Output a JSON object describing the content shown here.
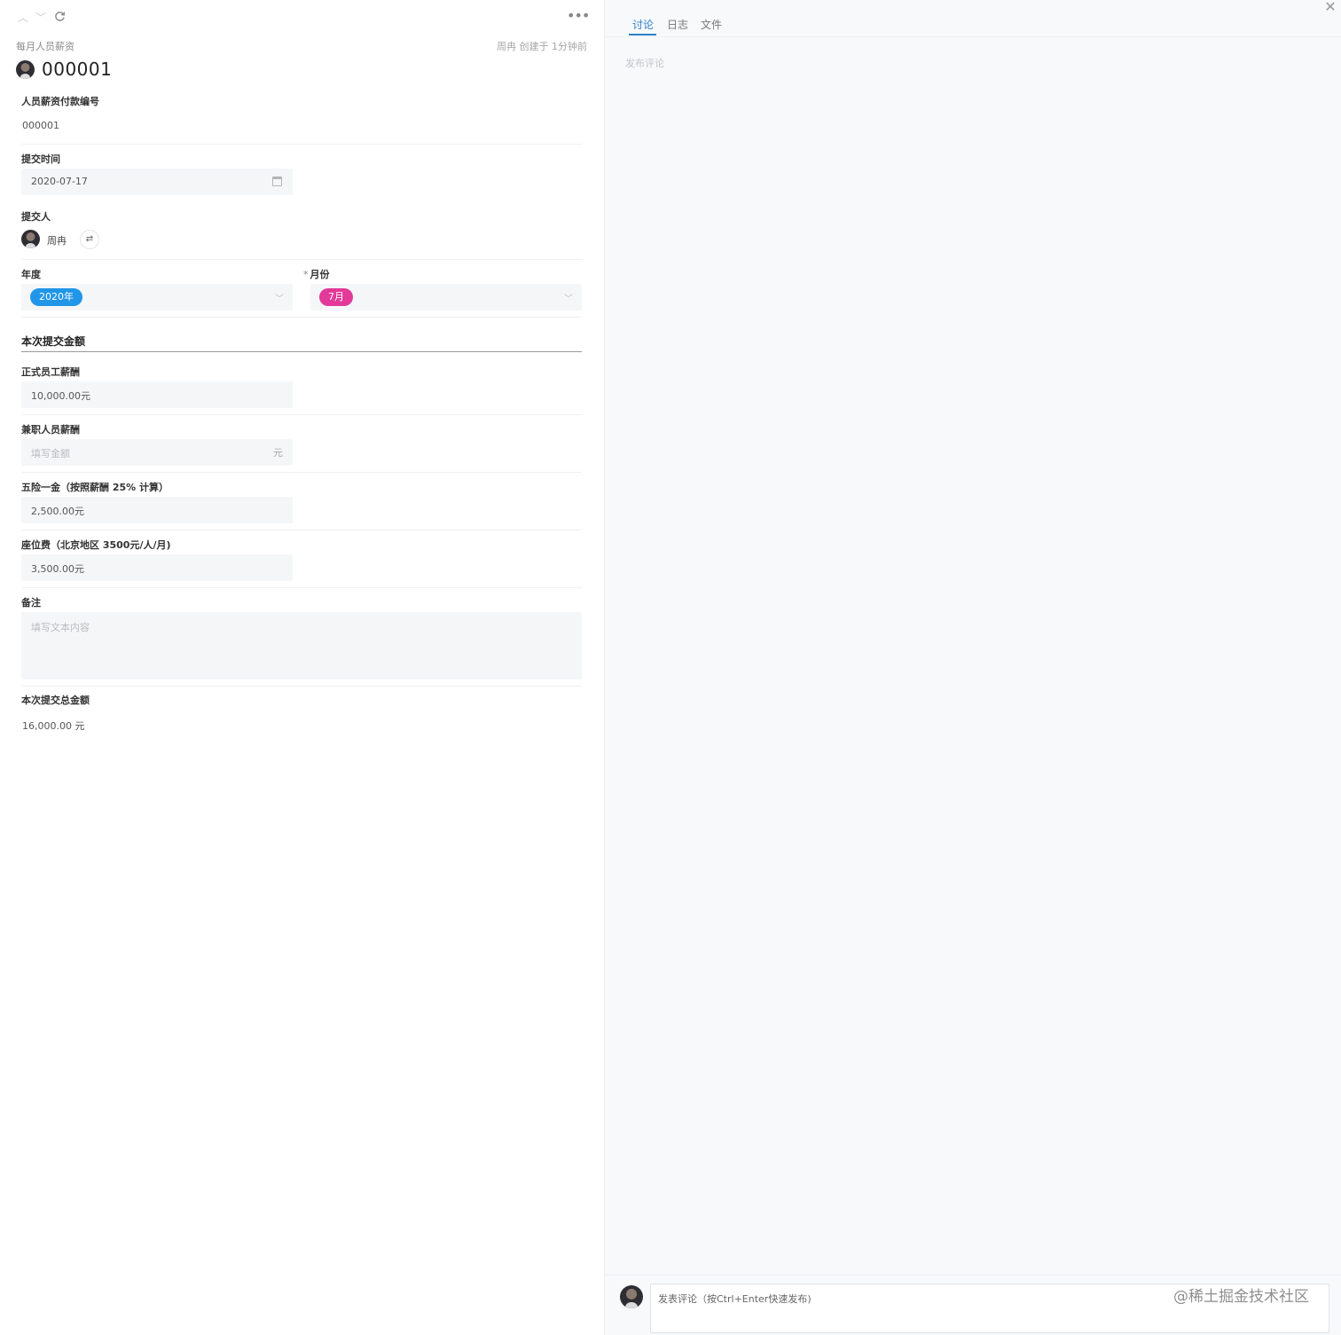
{
  "record": {
    "app_name": "每月人员薪资",
    "created_info": "周冉 创建于 1分钟前",
    "title": "000001"
  },
  "fields": {
    "payment_no": {
      "label": "人员薪资付款编号",
      "value": "000001"
    },
    "submit_time": {
      "label": "提交时间",
      "value": "2020-07-17"
    },
    "submitter": {
      "label": "提交人",
      "name": "周冉"
    },
    "year": {
      "label": "年度",
      "value": "2020年",
      "tag_color": "#2196e8"
    },
    "month": {
      "label": "月份",
      "required_mark": "*",
      "value": "7月",
      "tag_color": "#e23a98"
    },
    "section": {
      "title": "本次提交金额"
    },
    "regular_salary": {
      "label": "正式员工薪酬",
      "value": "10,000.00元"
    },
    "parttime_salary": {
      "label": "兼职人员薪酬",
      "placeholder": "填写金额",
      "suffix": "元"
    },
    "insurance": {
      "label": "五险一金（按照薪酬 25% 计算）",
      "value": "2,500.00元"
    },
    "seat_fee": {
      "label": "座位费（北京地区 3500元/人/月)",
      "value": "3,500.00元"
    },
    "remark": {
      "label": "备注",
      "placeholder": "填写文本内容"
    },
    "total": {
      "label": "本次提交总金额",
      "value": "16,000.00 元"
    }
  },
  "side_panel": {
    "tabs": [
      {
        "label": "讨论",
        "active": true
      },
      {
        "label": "日志",
        "active": false
      },
      {
        "label": "文件",
        "active": false
      }
    ],
    "publish_hint": "发布评论",
    "composer_placeholder": "发表评论（按Ctrl+Enter快速发布)",
    "watermark": "@稀土掘金技术社区",
    "accent_color": "#2f7fc8"
  },
  "icons": {
    "prev": "chevron-up-icon",
    "next": "chevron-down-icon",
    "refresh": "refresh-icon",
    "more": "more-icon",
    "calendar": "calendar-icon",
    "swap": "swap-icon",
    "dropdown": "chevron-down-icon",
    "close": "close-icon"
  }
}
